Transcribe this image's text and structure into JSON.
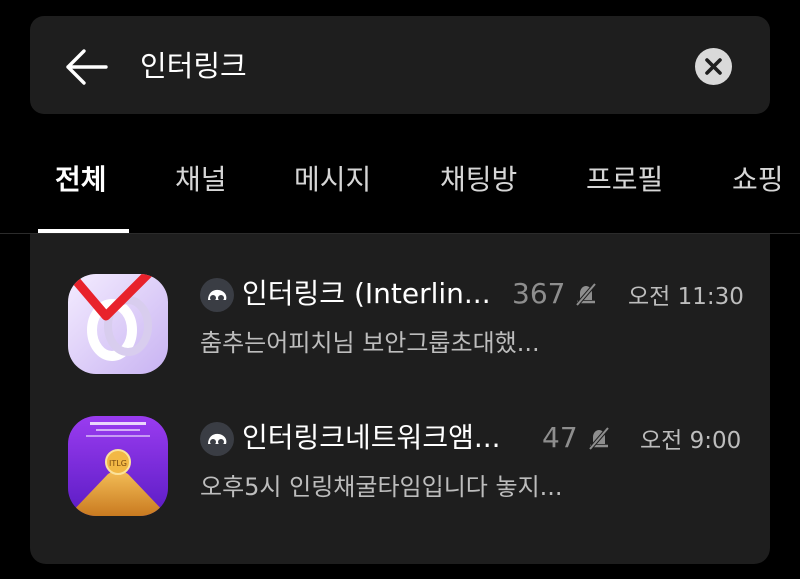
{
  "search": {
    "query": "인터링크"
  },
  "tabs": [
    {
      "label": "전체",
      "active": true
    },
    {
      "label": "채널",
      "active": false
    },
    {
      "label": "메시지",
      "active": false
    },
    {
      "label": "채팅방",
      "active": false
    },
    {
      "label": "프로필",
      "active": false
    },
    {
      "label": "쇼핑",
      "active": false
    }
  ],
  "results": [
    {
      "title": "인터링크 (Interlin...",
      "member_count": "367",
      "muted": true,
      "time": "오전 11:30",
      "preview": "춤추는어피치님 보안그룹초대했..."
    },
    {
      "title": "인터링크네트워크앰...",
      "member_count": "47",
      "muted": true,
      "time": "오전 9:00",
      "preview": "오후5시 인링채굴타임입니다 놓지...",
      "thumb_text": "ITLG"
    }
  ],
  "colors": {
    "background": "#000000",
    "panel": "#1e1e1e",
    "checkmark": "#e8222b",
    "thumb2_purple": "#7a2bd6",
    "thumb2_gold": "#e7a23a"
  }
}
